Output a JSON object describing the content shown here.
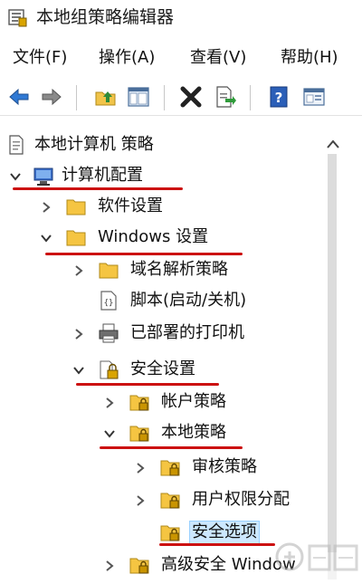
{
  "window": {
    "title": "本地组策略编辑器",
    "icon": "group-policy-icon"
  },
  "menu": {
    "items": [
      {
        "label": "文件(F)"
      },
      {
        "label": "操作(A)"
      },
      {
        "label": "查看(V)"
      },
      {
        "label": "帮助(H)"
      }
    ]
  },
  "toolbar": {
    "buttons": [
      {
        "icon": "back-arrow-icon"
      },
      {
        "icon": "forward-arrow-icon"
      },
      {
        "icon": "up-folder-icon"
      },
      {
        "icon": "show-hide-tree-icon"
      },
      {
        "icon": "delete-x-icon"
      },
      {
        "icon": "export-list-icon"
      },
      {
        "icon": "help-icon"
      },
      {
        "icon": "properties-view-icon"
      }
    ]
  },
  "tree": {
    "root": {
      "label": "本地计算机 策略",
      "icon": "policy-doc-icon"
    },
    "computer_config": {
      "label": "计算机配置",
      "icon": "computer-icon",
      "expanded": true
    },
    "software_settings": {
      "label": "软件设置",
      "icon": "folder-icon",
      "expanded": false
    },
    "windows_settings": {
      "label": "Windows 设置",
      "icon": "folder-icon",
      "expanded": true
    },
    "name_resolution": {
      "label": "域名解析策略",
      "icon": "folder-icon",
      "expanded": false
    },
    "scripts": {
      "label": "脚本(启动/关机)",
      "icon": "script-icon"
    },
    "printers": {
      "label": "已部署的打印机",
      "icon": "printer-icon",
      "expanded": false
    },
    "security_settings": {
      "label": "安全设置",
      "icon": "security-folder-icon",
      "expanded": true
    },
    "account_policies": {
      "label": "帐户策略",
      "icon": "lock-folder-icon",
      "expanded": false
    },
    "local_policies": {
      "label": "本地策略",
      "icon": "lock-folder-icon",
      "expanded": true
    },
    "audit_policy": {
      "label": "审核策略",
      "icon": "lock-folder-icon",
      "expanded": false
    },
    "user_rights": {
      "label": "用户权限分配",
      "icon": "lock-folder-icon",
      "expanded": false
    },
    "security_options": {
      "label": "安全选项",
      "icon": "lock-folder-icon",
      "selected": true
    },
    "advanced_firewall": {
      "label": "高级安全 Window",
      "icon": "lock-folder-icon",
      "expanded": false
    }
  },
  "annotations": {
    "color": "#cc1111"
  },
  "colors": {
    "selection": "#cce8ff",
    "folder": "#f5c542",
    "arrow_blue": "#3a7bd5"
  }
}
